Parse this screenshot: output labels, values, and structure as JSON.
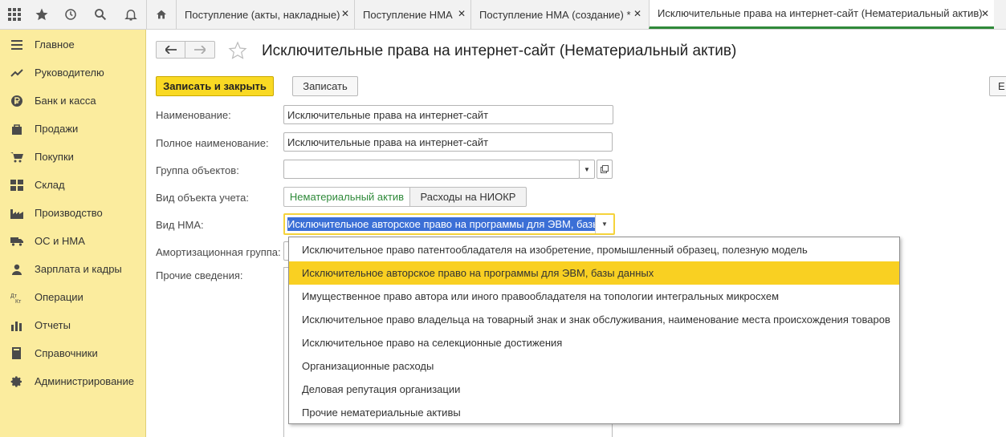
{
  "topbar": {
    "icons": [
      "apps-grid-icon",
      "star-icon",
      "history-icon",
      "search-icon",
      "bell-icon",
      "home-icon"
    ],
    "tabs": [
      {
        "label": "Поступление (акты, накладные)",
        "close": "✕"
      },
      {
        "label": "Поступление НМА",
        "close": "✕"
      },
      {
        "label": "Поступление НМА (создание) *",
        "close": "✕"
      },
      {
        "label": "Исключительные права на интернет-сайт (Нематериальный актив)",
        "close": "✕"
      }
    ]
  },
  "sidebar": {
    "items": [
      {
        "label": "Главное",
        "icon": "menu-icon"
      },
      {
        "label": "Руководителю",
        "icon": "trend-icon"
      },
      {
        "label": "Банк и касса",
        "icon": "ruble-icon"
      },
      {
        "label": "Продажи",
        "icon": "bag-icon"
      },
      {
        "label": "Покупки",
        "icon": "cart-icon"
      },
      {
        "label": "Склад",
        "icon": "warehouse-icon"
      },
      {
        "label": "Производство",
        "icon": "factory-icon"
      },
      {
        "label": "ОС и НМА",
        "icon": "truck-icon"
      },
      {
        "label": "Зарплата и кадры",
        "icon": "person-icon"
      },
      {
        "label": "Операции",
        "icon": "dt-kt-icon"
      },
      {
        "label": "Отчеты",
        "icon": "bar-chart-icon"
      },
      {
        "label": "Справочники",
        "icon": "book-icon"
      },
      {
        "label": "Администрирование",
        "icon": "gear-icon"
      }
    ]
  },
  "form": {
    "title": "Исключительные права на интернет-сайт (Нематериальный актив)",
    "save_close_label": "Записать и закрыть",
    "save_label": "Записать",
    "more_label": "Е",
    "name_label": "Наименование:",
    "name_value": "Исключительные права на интернет-сайт",
    "fullname_label": "Полное наименование:",
    "fullname_value": "Исключительные права на интернет-сайт",
    "group_label": "Группа объектов:",
    "group_value": "",
    "accounting_type_label": "Вид объекта учета:",
    "accounting_type_options": [
      "Нематериальный актив",
      "Расходы на НИОКР"
    ],
    "nma_type_label": "Вид НМА:",
    "nma_type_value": "Исключительное авторское право на программы для ЭВМ, базы",
    "amort_group_label": "Амортизационная группа:",
    "other_label": "Прочие сведения:"
  },
  "dropdown": {
    "selected_index": 1,
    "items": [
      "Исключительное право патентообладателя на изобретение, промышленный образец, полезную модель",
      "Исключительное авторское право на программы для ЭВМ, базы данных",
      "Имущественное право автора или иного правообладателя на топологии интегральных микросхем",
      "Исключительное право владельца на товарный знак и знак обслуживания, наименование места происхождения товаров",
      "Исключительное право на селекционные достижения",
      "Организационные расходы",
      "Деловая репутация организации",
      "Прочие нематериальные активы"
    ]
  },
  "colors": {
    "sidebar_bg": "#fbec9e",
    "primary_button": "#f9d923",
    "selected_item": "#f9d022",
    "active_tab_underline": "#2f8a3a",
    "active_segment_text": "#2f8a3a",
    "selection_highlight": "#3b6fd6"
  }
}
